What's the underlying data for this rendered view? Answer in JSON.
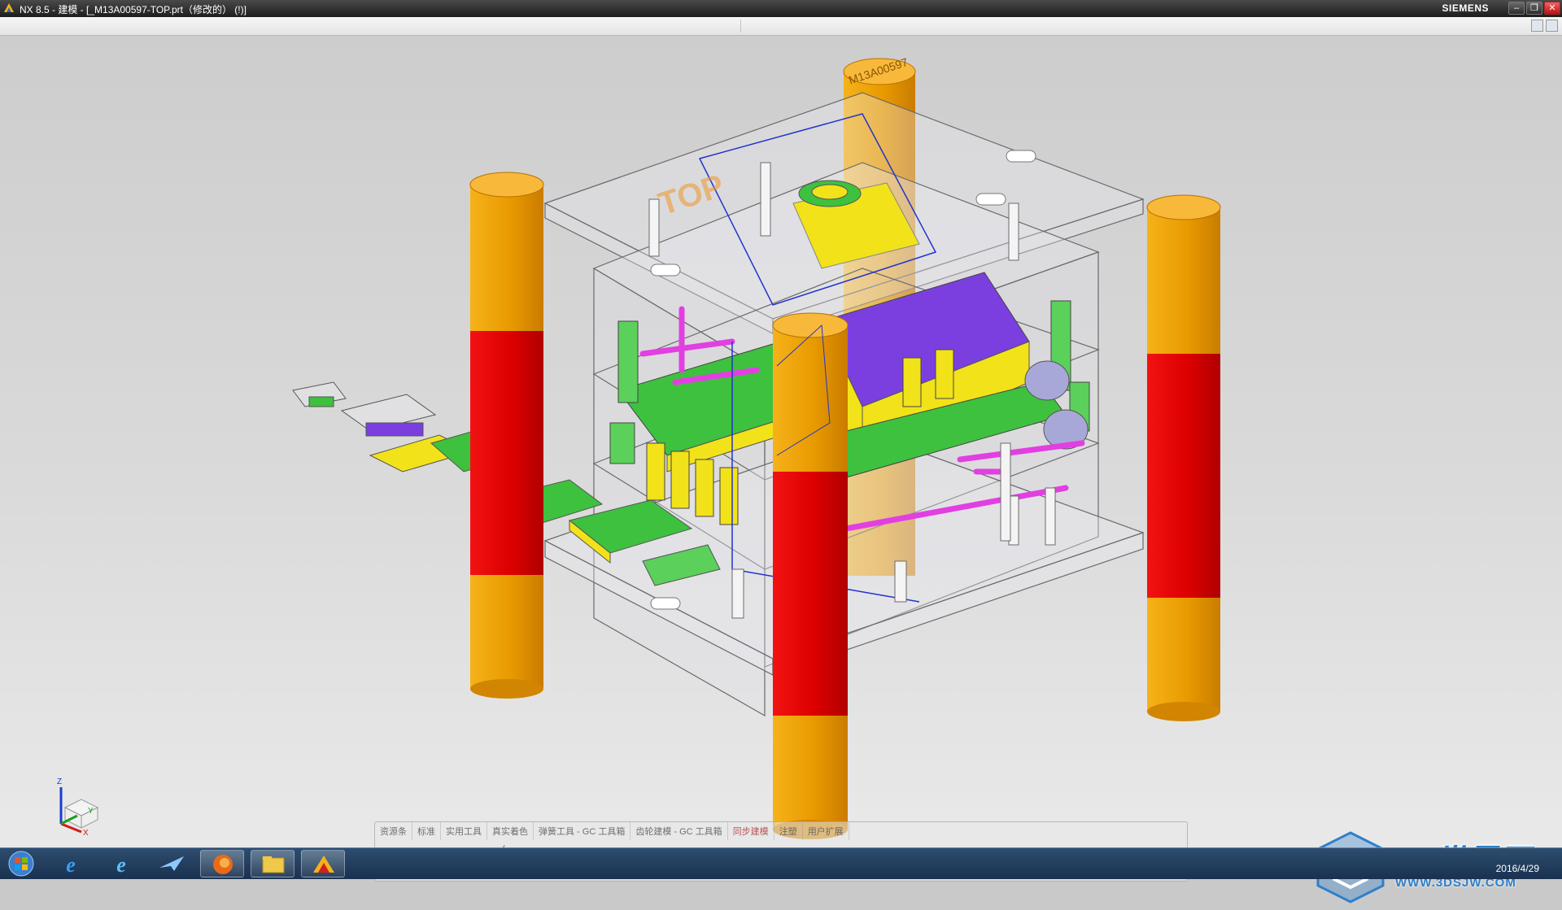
{
  "window": {
    "title": "NX 8.5 - 建模 - [_M13A00597-TOP.prt（修改的）  (!)]",
    "brand": "SIEMENS",
    "minimize": "–",
    "restore": "❐",
    "close": "✕"
  },
  "model": {
    "stamp_text": "M13A00597",
    "part_label": "TOP"
  },
  "toolbar": {
    "tabs": [
      "资源条",
      "标准",
      "实用工具",
      "真实着色",
      "弹簧工具 - GC 工具箱",
      "齿轮建模 - GC 工具箱",
      "同步建模",
      "注塑",
      "用户扩展"
    ],
    "active_tab": "同步建模",
    "icons": [
      "sketch-icon",
      "datum-plane-icon",
      "curve-icon",
      "line-icon",
      "arc-icon",
      "circle-icon",
      "fillet-icon",
      "rectangle-icon",
      "spline-icon",
      "point-icon",
      "extrude-icon",
      "revolve-icon",
      "hole-icon",
      "boolean-icon",
      "blend-icon",
      "chamfer-icon",
      "shell-icon",
      "draft-icon",
      "mirror-icon",
      "pattern-icon",
      "assembly-icon",
      "book-icon",
      "mold-icon",
      "view-icon"
    ]
  },
  "triad": {
    "z": "Z",
    "y": "Y",
    "x": "X"
  },
  "taskbar": {
    "apps": [
      "start-button",
      "ie-icon",
      "ie-alt-icon",
      "nx-plane-icon",
      "firefox-icon",
      "explorer-icon",
      "nx-app-icon"
    ],
    "date": "2016/4/29"
  },
  "watermark": {
    "text": "3D世界网",
    "url": "WWW.3DSJW.COM"
  },
  "colors": {
    "viewport": "#d6d6d6",
    "pillar_orange": "#f0a000",
    "pillar_red": "#e00000",
    "plate_outline": "#6a6a6a",
    "core_yellow": "#f2e21a",
    "core_purple": "#7b3fe0",
    "core_green": "#3ec13e",
    "cooling_magenta": "#e23fe2"
  }
}
